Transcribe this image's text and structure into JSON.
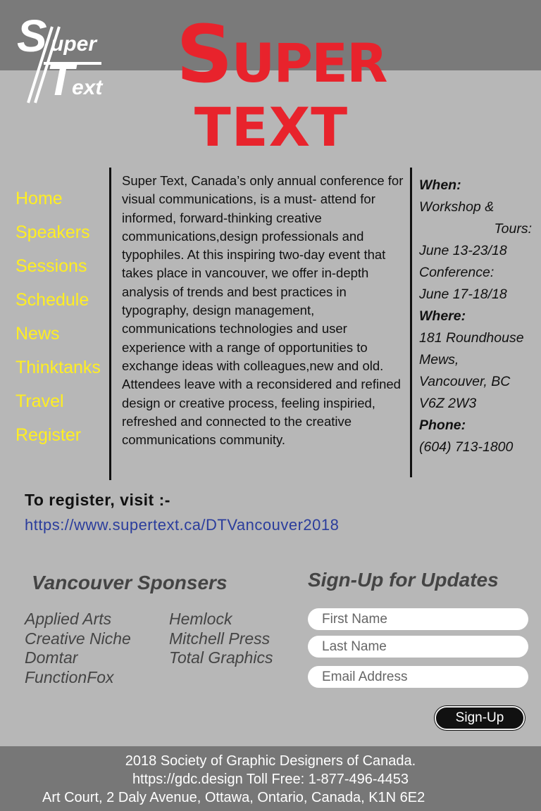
{
  "logo": {
    "s": "S",
    "uper": "uper",
    "t": "T",
    "ext": "ext"
  },
  "title": {
    "line1_first": "S",
    "line1_rest": "UPER",
    "line2": "TEXT"
  },
  "nav": {
    "items": [
      "Home",
      "Speakers",
      "Sessions",
      "Schedule",
      "News",
      "Thinktanks",
      "Travel",
      "Register"
    ]
  },
  "description": "Super Text, Canada’s only annual conference for visual communications, is a must- attend for informed, forward-thinking creative communications,design professionals and typophiles. At this inspiring two-day event that takes place in vancouver, we offer in-depth analysis of trends and best practices in typography, design management, communications technologies and user experience with a range of opportunities to exchange ideas with colleagues,new and old. Attendees leave with a reconsidered and refined design or creative process, feeling inspiried, refreshed and connected to the creative communications community.",
  "info": {
    "when_label": "When:",
    "workshop_label": "Workshop &",
    "tours_label": "Tours:",
    "workshop_dates": "June 13-23/18",
    "conference_label": "Conference:",
    "conference_dates": "June 17-18/18",
    "where_label": "Where:",
    "address1": "181 Roundhouse",
    "address2": "Mews,",
    "address3": "Vancouver, BC",
    "address4": "V6Z 2W3",
    "phone_label": "Phone:",
    "phone": "(604) 713-1800"
  },
  "register": {
    "heading": "To register, visit :-",
    "url": "https://www.supertext.ca/DTVancouver2018"
  },
  "sponsors": {
    "heading": "Vancouver Sponsers",
    "col1": [
      "Applied Arts",
      "Creative Niche",
      "Domtar",
      "FunctionFox"
    ],
    "col2": [
      "Hemlock",
      "Mitchell Press",
      "Total Graphics"
    ]
  },
  "signup": {
    "heading": "Sign-Up for Updates",
    "first_name_placeholder": "First Name",
    "last_name_placeholder": "Last Name",
    "email_placeholder": "Email Address",
    "button_label": "Sign-Up"
  },
  "footer": {
    "line1": "2018 Society of Graphic Designers of Canada.",
    "line2": "https://gdc.design  Toll Free: 1-877-496-4453",
    "line3": "Art Court, 2 Daly Avenue, Ottawa, Ontario, Canada, K1N 6E2"
  },
  "colors": {
    "title_red": "#e8232c",
    "nav_yellow": "#ffee22",
    "link_blue": "#2b3d9c",
    "band_gray": "#7a7a7a",
    "page_gray": "#b7b7b7"
  }
}
